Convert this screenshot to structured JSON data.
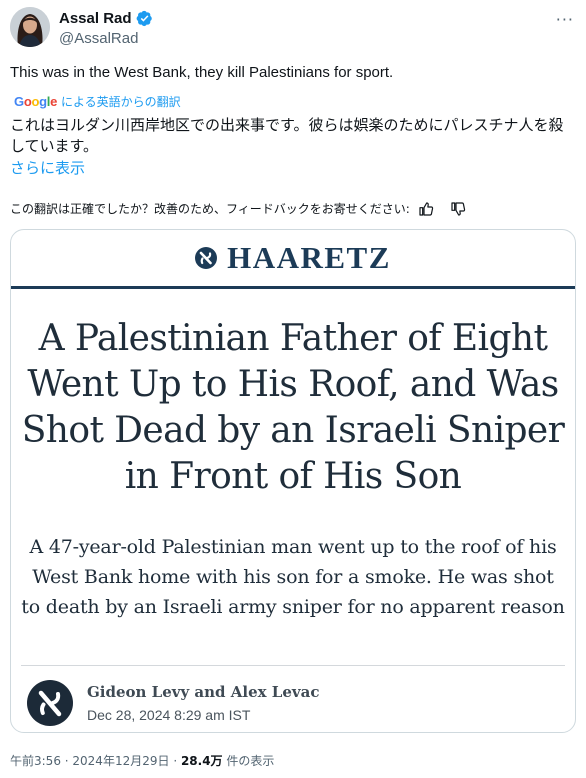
{
  "author": {
    "display_name": "Assal Rad",
    "handle": "@AssalRad"
  },
  "tweet": {
    "text": "This was in the West Bank, they kill Palestinians for sport.",
    "translation_provider": "Google",
    "translation_label": "による英語からの翻訳",
    "translated_text": "これはヨルダン川西岸地区での出来事です。彼らは娯楽のためにパレスチナ人を殺しています。",
    "show_more": "さらに表示",
    "feedback_prompt": "この翻訳は正確でしたか？改善のため、フィードバックをお寄せください:"
  },
  "card": {
    "masthead": "HAARETZ",
    "headline": "A Palestinian Father of Eight Went Up to His Roof, and Was Shot Dead by an Israeli Sniper in Front of His Son",
    "subhead": "A 47-year-old Palestinian man went up to the roof of his West Bank home with his son for a smoke. He was shot to death by an Israeli army sniper for no apparent reason",
    "authors": "Gideon Levy and Alex Levac",
    "date": "Dec 28, 2024 8:29 am IST"
  },
  "meta": {
    "time": "午前3:56",
    "separator": " · ",
    "date": "2024年12月29日",
    "views_count": "28.4万",
    "views_label": " 件の表示"
  },
  "colors": {
    "link": "#1d9bf0",
    "verified": "#1d9bf0",
    "haaretz_navy": "#1c3b57"
  },
  "icons": [
    "verified-badge-icon",
    "more-icon",
    "thumbs-up-icon",
    "thumbs-down-icon",
    "haaretz-logo-icon"
  ]
}
